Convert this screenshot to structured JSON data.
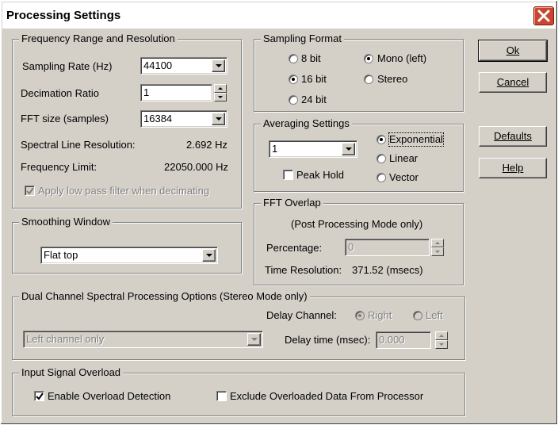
{
  "window": {
    "title": "Processing Settings"
  },
  "freq": {
    "group_label": "Frequency Range and Resolution",
    "sampling_rate_label": "Sampling Rate (Hz)",
    "sampling_rate_value": "44100",
    "decimation_label": "Decimation Ratio",
    "decimation_value": "1",
    "fft_size_label": "FFT size (samples)",
    "fft_size_value": "16384",
    "spectral_line_label": "Spectral Line Resolution:",
    "spectral_line_value": "2.692 Hz",
    "freq_limit_label": "Frequency Limit:",
    "freq_limit_value": "22050.000 Hz",
    "low_pass_label": "Apply low pass filter when decimating",
    "low_pass_checked": true
  },
  "sampling_format": {
    "group_label": "Sampling Format",
    "bit8": "8 bit",
    "bit16": "16 bit",
    "bit24": "24 bit",
    "mono": "Mono (left)",
    "stereo": "Stereo",
    "selected_bits": "16 bit",
    "selected_channel": "Mono (left)"
  },
  "averaging": {
    "group_label": "Averaging Settings",
    "value": "1",
    "peak_hold_label": "Peak Hold",
    "peak_hold_checked": false,
    "exponential": "Exponential",
    "linear": "Linear",
    "vector": "Vector",
    "selected": "Exponential"
  },
  "smoothing": {
    "group_label": "Smoothing Window",
    "value": "Flat top"
  },
  "fft_overlap": {
    "group_label": "FFT Overlap",
    "note": "(Post Processing Mode only)",
    "percentage_label": "Percentage:",
    "percentage_value": "0",
    "time_res_label": "Time Resolution:",
    "time_res_value": "371.52 (msecs)"
  },
  "dual_channel": {
    "group_label": "Dual Channel Spectral Processing Options (Stereo Mode only)",
    "delay_channel_label": "Delay Channel:",
    "right": "Right",
    "left": "Left",
    "selected": "Right",
    "mode_value": "Left channel only",
    "delay_time_label": "Delay time (msec):",
    "delay_time_value": "0.000"
  },
  "overload": {
    "group_label": "Input Signal Overload",
    "enable_label": "Enable Overload Detection",
    "enable_checked": true,
    "exclude_label": "Exclude Overloaded Data From Processor",
    "exclude_checked": false
  },
  "buttons": {
    "ok": "Ok",
    "cancel": "Cancel",
    "defaults": "Defaults",
    "help": "Help"
  }
}
